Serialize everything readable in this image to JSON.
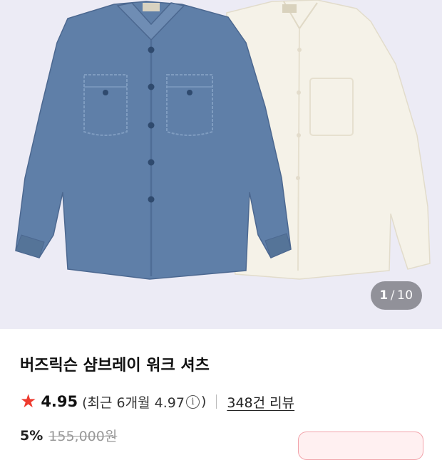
{
  "gallery": {
    "current": "1",
    "separator": "/",
    "total": "10"
  },
  "product": {
    "title": "버즈릭슨 샴브레이 워크 셔츠",
    "rating": "4.95",
    "recent_prefix": "(최근 6개월 4.97",
    "recent_suffix": ")",
    "reviews": "348건 리뷰"
  },
  "price": {
    "discount": "5%",
    "original": "155,000원"
  },
  "colors": {
    "accent_star": "#ee3b2f",
    "gallery_bg": "#ecebf5",
    "blue_shirt": "#5f7fa8",
    "white_shirt": "#f5f2e8"
  }
}
